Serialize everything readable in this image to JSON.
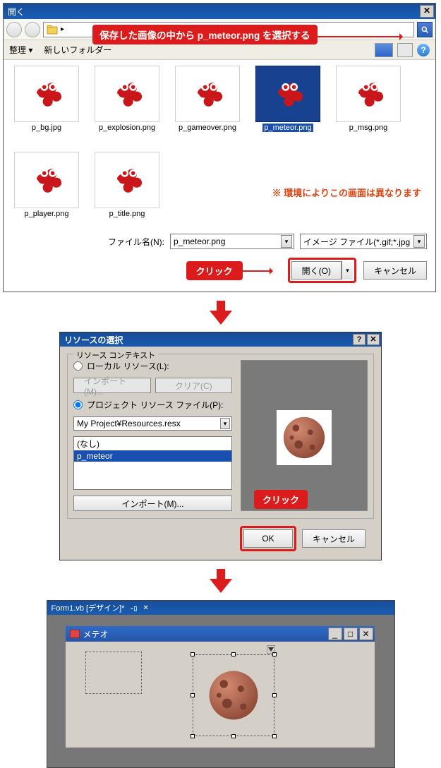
{
  "dialog1": {
    "title": "開く",
    "callout": "保存した画像の中から p_meteor.png を選択する",
    "organize": "整理 ▾",
    "newfolder": "新しいフォルダー",
    "files": [
      {
        "name": "p_bg.jpg"
      },
      {
        "name": "p_explosion.png"
      },
      {
        "name": "p_gameover.png"
      },
      {
        "name": "p_meteor.png",
        "selected": true
      },
      {
        "name": "p_msg.png"
      },
      {
        "name": "p_player.png"
      },
      {
        "name": "p_title.png"
      }
    ],
    "notice": "※ 環境によりこの画面は異なります",
    "filename_label": "ファイル名(N):",
    "filename_value": "p_meteor.png",
    "filter": "イメージ ファイル(*.gif;*.jpg",
    "open_btn": "開く(O)",
    "cancel_btn": "キャンセル",
    "click": "クリック"
  },
  "dialog2": {
    "title": "リソースの選択",
    "group_legend": "リソース コンテキスト",
    "radio_local": "ローカル リソース(L):",
    "radio_proj": "プロジェクト リソース ファイル(P):",
    "import_btn": "インポート(M)...",
    "clear_btn": "クリア(C)",
    "combo_value": "My Project¥Resources.resx",
    "list_none": "(なし)",
    "list_item": "p_meteor",
    "ok": "OK",
    "cancel": "キャンセル",
    "click": "クリック"
  },
  "dialog3": {
    "tab": "Form1.vb [デザイン]*",
    "tab_pin": "⊕",
    "tab_close": "✕",
    "form_title": "メテオ"
  }
}
